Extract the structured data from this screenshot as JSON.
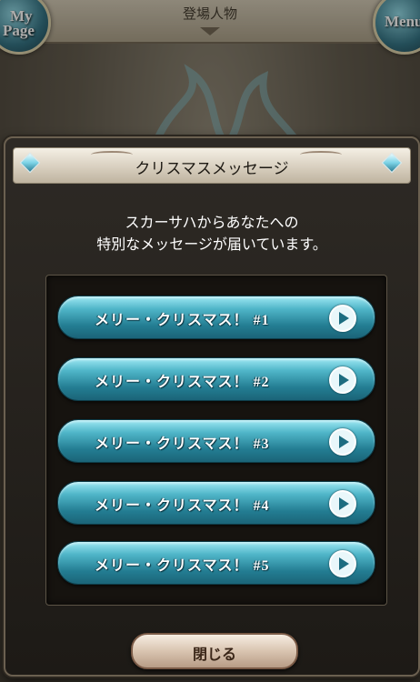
{
  "header": {
    "title": "登場人物",
    "mypage_label_line1": "My",
    "mypage_label_line2": "Page",
    "menu_label": "Menu"
  },
  "dialog": {
    "title": "クリスマスメッセージ",
    "message_line1": "スカーサハからあなたへの",
    "message_line2": "特別なメッセージが届いています。",
    "buttons": [
      {
        "label": "メリー・クリスマス！ #1"
      },
      {
        "label": "メリー・クリスマス！ #2"
      },
      {
        "label": "メリー・クリスマス！ #3"
      },
      {
        "label": "メリー・クリスマス！ #4"
      },
      {
        "label": "メリー・クリスマス！ #5"
      }
    ],
    "close_label": "閉じる"
  },
  "colors": {
    "button_accent": "#4fb5c8",
    "dialog_bg": "#1d1a16",
    "title_bar": "#d8cfbf"
  },
  "icons": [
    "play-icon",
    "gem-ornament"
  ]
}
